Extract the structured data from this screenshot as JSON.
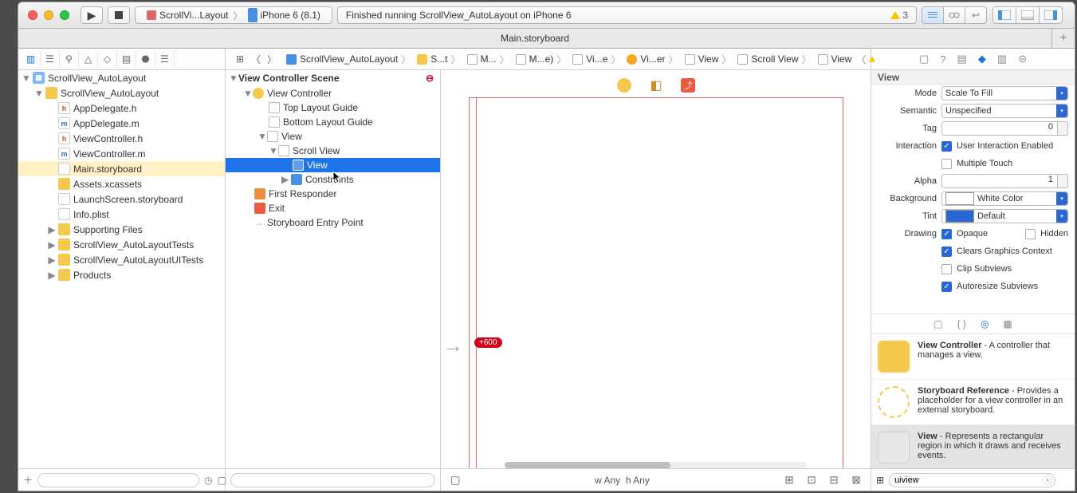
{
  "toolbar": {
    "scheme_target": "ScrollVi...Layout",
    "scheme_device": "iPhone 6 (8.1)",
    "status_text": "Finished running ScrollView_AutoLayout on iPhone 6",
    "warning_count": "3"
  },
  "tabbar": {
    "tab0": "Main.storyboard"
  },
  "jumpbar": {
    "project": "ScrollView_AutoLayout",
    "group": "S...t",
    "file": "M...",
    "base": "M...e)",
    "scene": "Vi...e",
    "vc": "Vi...er",
    "view": "View",
    "scroll": "Scroll View",
    "inner": "View"
  },
  "nav": {
    "root": "ScrollView_AutoLayout",
    "group_main": "ScrollView_AutoLayout",
    "files": {
      "appdelegate_h": "AppDelegate.h",
      "appdelegate_m": "AppDelegate.m",
      "vc_h": "ViewController.h",
      "vc_m": "ViewController.m",
      "mainsb": "Main.storyboard",
      "assets": "Assets.xcassets",
      "launch": "LaunchScreen.storyboard",
      "info": "Info.plist"
    },
    "supporting": "Supporting Files",
    "tests": "ScrollView_AutoLayoutTests",
    "uitests": "ScrollView_AutoLayoutUITests",
    "products": "Products"
  },
  "outline": {
    "scene": "View Controller Scene",
    "vc": "View Controller",
    "top": "Top Layout Guide",
    "bottom": "Bottom Layout Guide",
    "view": "View",
    "scroll": "Scroll View",
    "innerview": "View",
    "constraints": "Constraints",
    "first": "First Responder",
    "exit": "Exit",
    "entry": "Storyboard Entry Point"
  },
  "canvas": {
    "size_w": "w Any",
    "size_h": "h Any",
    "pill": "+600"
  },
  "inspector": {
    "header": "View",
    "mode_label": "Mode",
    "mode_value": "Scale To Fill",
    "semantic_label": "Semantic",
    "semantic_value": "Unspecified",
    "tag_label": "Tag",
    "tag_value": "0",
    "interaction_label": "Interaction",
    "uie": "User Interaction Enabled",
    "mt": "Multiple Touch",
    "alpha_label": "Alpha",
    "alpha_value": "1",
    "background_label": "Background",
    "background_value": "White Color",
    "tint_label": "Tint",
    "tint_value": "Default",
    "drawing_label": "Drawing",
    "opaque": "Opaque",
    "hidden": "Hidden",
    "clears": "Clears Graphics Context",
    "clip": "Clip Subviews",
    "autoresize": "Autoresize Subviews"
  },
  "library": {
    "vc_title": "View Controller",
    "vc_desc": " - A controller that manages a view.",
    "sr_title": "Storyboard Reference",
    "sr_desc": " - Provides a placeholder for a view controller in an external storyboard.",
    "view_title": "View",
    "view_desc": " - Represents a rectangular region in which it draws and receives events.",
    "filter": "uiview"
  }
}
